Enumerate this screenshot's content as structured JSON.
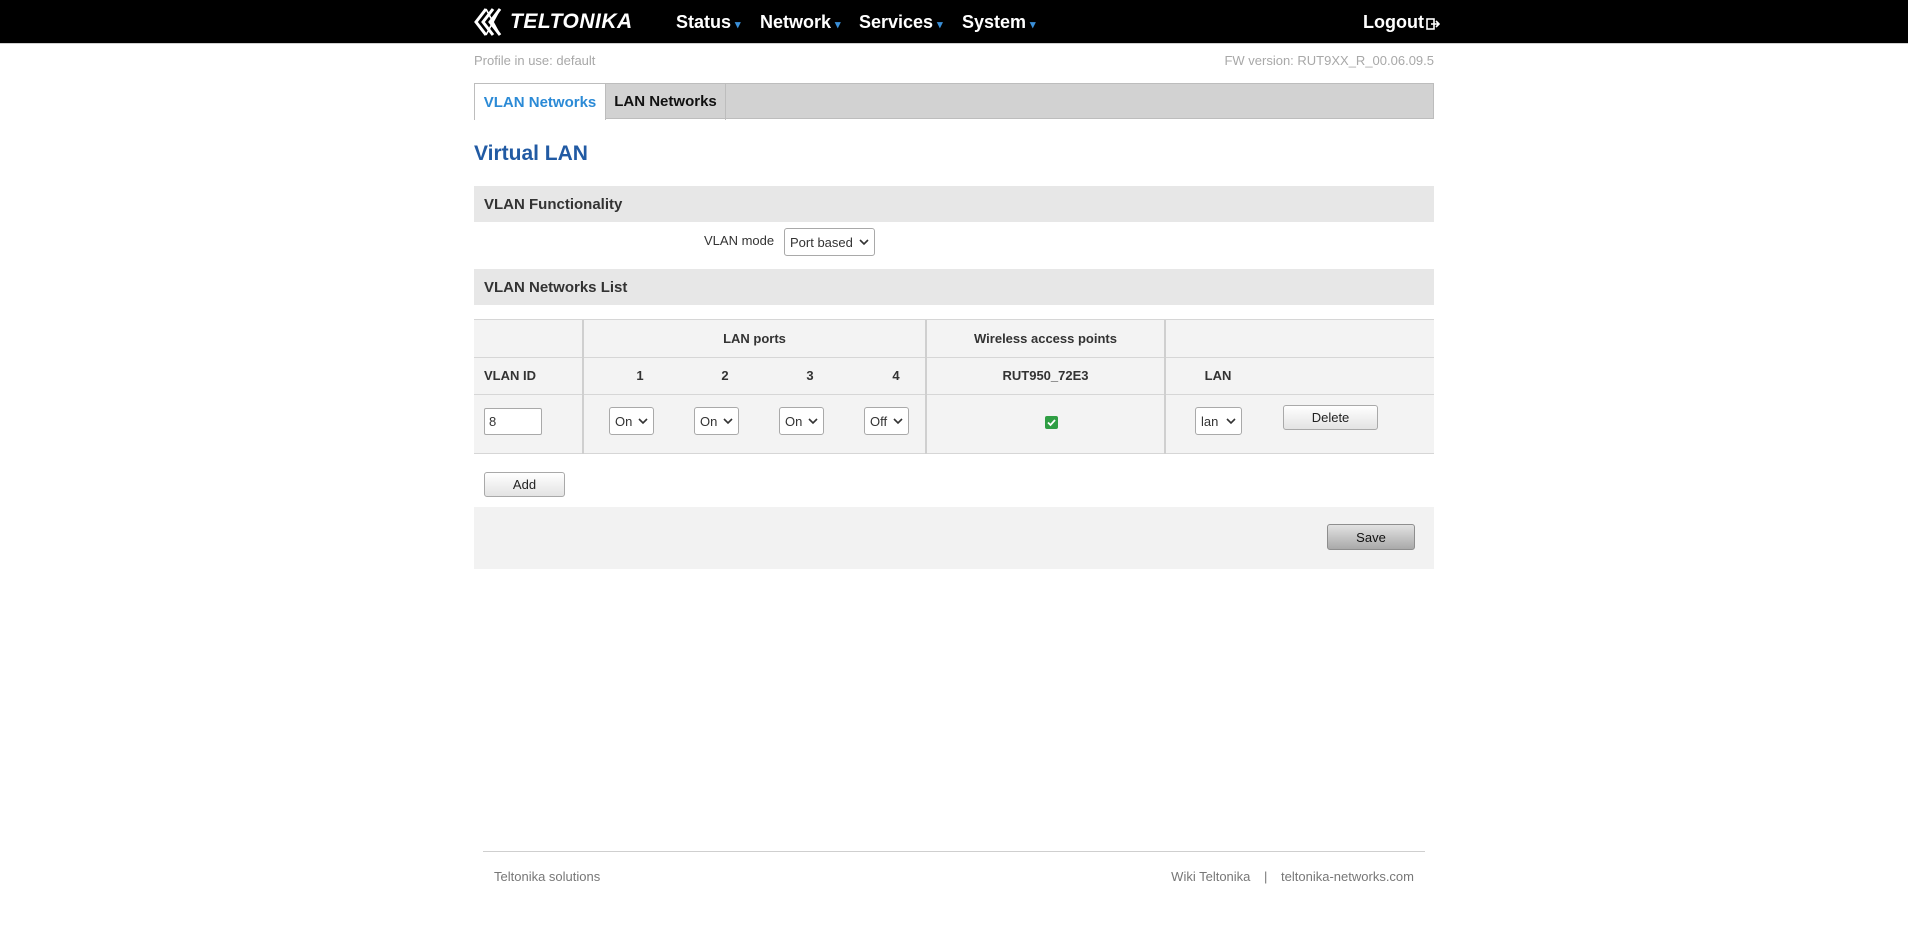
{
  "brand": {
    "logo_text": "TELTONIKA"
  },
  "nav": {
    "items": [
      {
        "label": "Status"
      },
      {
        "label": "Network"
      },
      {
        "label": "Services"
      },
      {
        "label": "System"
      }
    ],
    "logout_label": "Logout"
  },
  "profile_text": "Profile in use: default",
  "fw_text": "FW version: RUT9XX_R_00.06.09.5",
  "tabs": [
    {
      "label": "VLAN Networks",
      "active": true
    },
    {
      "label": "LAN Networks",
      "active": false
    }
  ],
  "page_title": "Virtual LAN",
  "functionality": {
    "title": "VLAN Functionality",
    "vlan_mode_label": "VLAN mode",
    "vlan_mode_value": "Port based"
  },
  "networks": {
    "title": "VLAN Networks List",
    "group_headers": {
      "lan_ports": "LAN ports",
      "wireless": "Wireless access points"
    },
    "columns": {
      "vlan_id": "VLAN ID",
      "ports": [
        "1",
        "2",
        "3",
        "4"
      ],
      "ap": "RUT950_72E3",
      "lan": "LAN"
    },
    "rows": [
      {
        "vlan_id": "8",
        "ports": [
          "On",
          "On",
          "On",
          "Off"
        ],
        "ap_checked": true,
        "lan": "lan",
        "delete_label": "Delete"
      }
    ],
    "add_label": "Add"
  },
  "save_label": "Save",
  "footer": {
    "left": "Teltonika solutions",
    "links": [
      "Wiki Teltonika",
      "teltonika-networks.com"
    ],
    "separator": "|"
  },
  "colors": {
    "topbar": "#000000",
    "accent_blue": "#2b8ad6",
    "title_blue": "#215aa3",
    "checkbox_green": "#2f9e44"
  }
}
